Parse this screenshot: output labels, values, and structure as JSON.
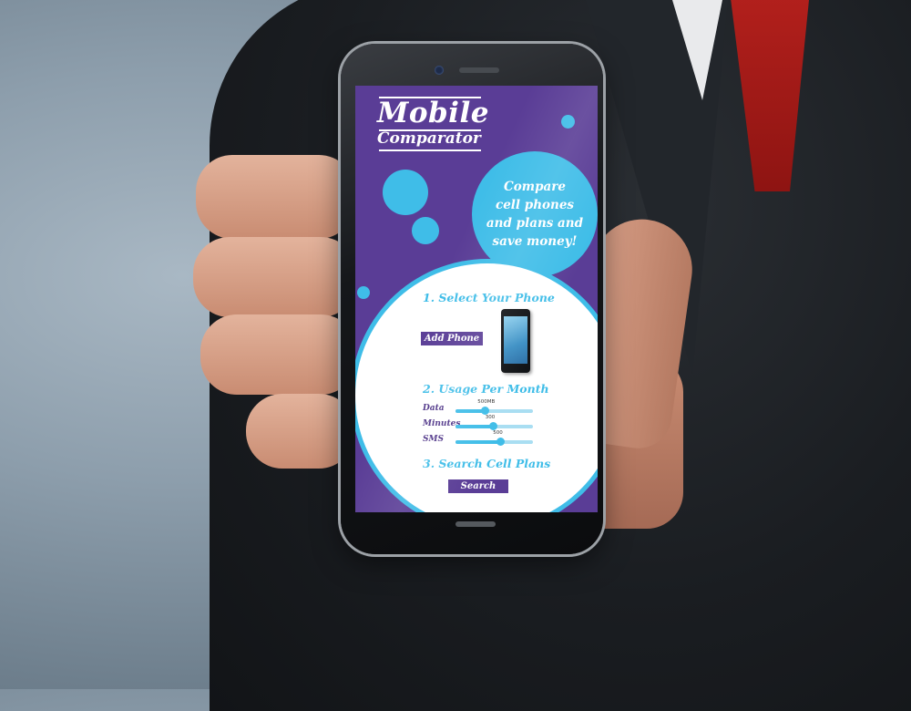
{
  "app": {
    "logo_title": "Mobile",
    "logo_subtitle": "Comparator"
  },
  "promo": {
    "text": "Compare\ncell phones\nand plans and\nsave money!"
  },
  "step1": {
    "title": "1. Select Your Phone",
    "add_button_label": "Add Phone"
  },
  "step2": {
    "title": "2. Usage Per Month",
    "sliders": [
      {
        "label": "Data",
        "value_label": "500MB",
        "level": 0.38
      },
      {
        "label": "Minutes",
        "value_label": "300",
        "level": 0.48
      },
      {
        "label": "SMS",
        "value_label": "500",
        "level": 0.58
      }
    ]
  },
  "step3": {
    "title": "3. Search Cell Plans",
    "search_button_label": "Search"
  },
  "colors": {
    "screen_background": "#5a3d96",
    "accent_blue": "#3fbde8",
    "button_purple": "#5a3d96"
  },
  "icons": {
    "phone_preview": "smartphone-icon",
    "decor_bubbles": "circle-bubble-icon"
  }
}
